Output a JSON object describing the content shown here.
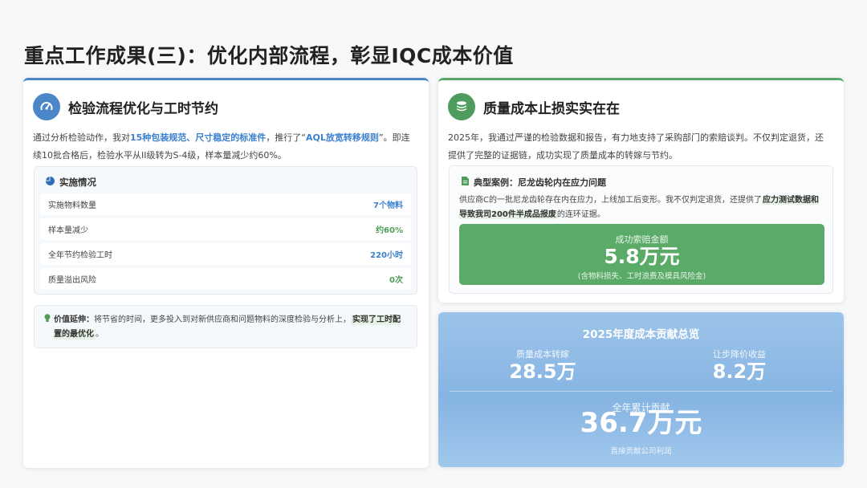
{
  "page_title": "重点工作成果(三)：优化内部流程，彰显IQC成本价值",
  "left": {
    "title": "检验流程优化与工时节约",
    "icon": "gauge-icon",
    "intro": {
      "p1": "通过分析检验动作，我对",
      "hl1": "15种包装规范、尺寸稳定的标准件",
      "p2": "，推行了“",
      "hl2": "AQL放宽转移规则",
      "p3": "”。即连续10批合格后，检验水平从II级转为S-4级，样本量减少约60%。"
    },
    "impl": {
      "title": "实施情况",
      "icon": "pie-chart-icon",
      "rows": [
        {
          "label": "实施物料数量",
          "value": "7个物料"
        },
        {
          "label": "样本量减少",
          "value": "约60%"
        },
        {
          "label": "全年节约检验工时",
          "value": "220小时"
        },
        {
          "label": "质量溢出风险",
          "value": "0次"
        }
      ]
    },
    "value_note": {
      "icon": "lightbulb-icon",
      "label": "价值延伸：",
      "text": "将节省的时间，更多投入到对新供应商和问题物料的深度检验与分析上，",
      "mark": "实现了工时配置的最优化",
      "end": "。"
    }
  },
  "right": {
    "title": "质量成本止损实实在在",
    "icon": "coins-icon",
    "intro": "2025年，我通过严谨的检验数据和报告，有力地支持了采购部门的索赔谈判。不仅判定退货，还提供了完整的证据链，成功实现了质量成本的转嫁与节约。",
    "case": {
      "icon": "document-icon",
      "title": "典型案例：尼龙齿轮内在应力问题",
      "text1": "供应商C的一批尼龙齿轮存在内在应力，上线加工后变形。我不仅判定退货，还提供了",
      "mark": "应力测试数据和导致我司200件半成品报废",
      "text2": "的连环证据。",
      "claim_label": "成功索赔金额",
      "claim_value": "5.8万元",
      "claim_note": "(含物料损失、工时浪费及模具风险金)"
    }
  },
  "overview": {
    "title": "2025年度成本贡献总览",
    "items": [
      {
        "label": "质量成本转嫁",
        "value": "28.5万"
      },
      {
        "label": "让步降价收益",
        "value": "8.2万"
      }
    ],
    "total_label": "全年累计贡献",
    "total_value": "36.7万元",
    "footnote": "直接贡献公司利润"
  },
  "colors": {
    "blue": "#4a86c8",
    "green": "#58a867",
    "overview_bg": "#8fbbe6"
  }
}
